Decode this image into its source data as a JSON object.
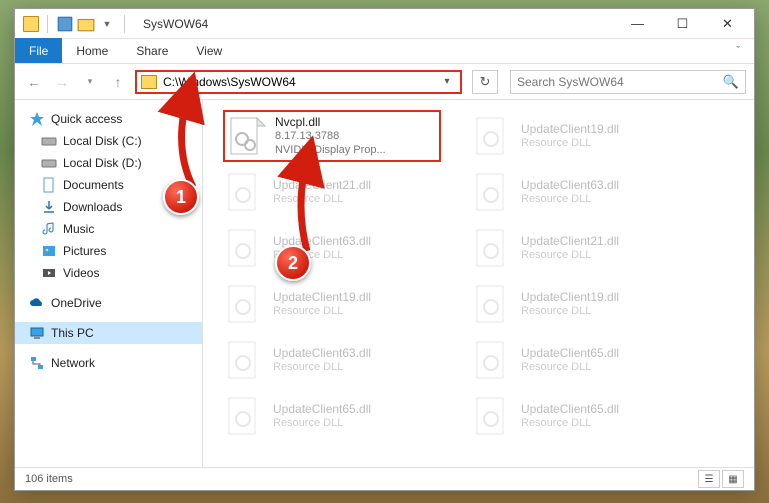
{
  "window": {
    "title": "SysWOW64",
    "controls": {
      "min": "—",
      "max": "☐",
      "close": "✕"
    }
  },
  "ribbon": {
    "file": "File",
    "tabs": [
      "Home",
      "Share",
      "View"
    ]
  },
  "address": {
    "path": "C:\\Windows\\SysWOW64",
    "dropdown": "▾",
    "refresh": "↻"
  },
  "search": {
    "placeholder": "Search SysWOW64",
    "icon": "🔍"
  },
  "nav": {
    "quick": "Quick access",
    "items": [
      "Local Disk (C:)",
      "Local Disk (D:)",
      "Documents",
      "Downloads",
      "Music",
      "Pictures",
      "Videos"
    ],
    "onedrive": "OneDrive",
    "thispc": "This PC",
    "network": "Network"
  },
  "files": {
    "highlighted": {
      "name": "Nvcpl.dll",
      "line2": "8.17.13.3788",
      "line3": "NVIDIA Display Prop..."
    },
    "faded_name": "UpdateClient19.dll",
    "faded_sub": "Resource DLL",
    "faded_name2": "UpdateClient21.dll",
    "faded_name3": "UpdateClient63.dll",
    "faded_name4": "UpdateClient65.dll"
  },
  "status": {
    "count": "106 items"
  },
  "callouts": {
    "one": "1",
    "two": "2"
  }
}
